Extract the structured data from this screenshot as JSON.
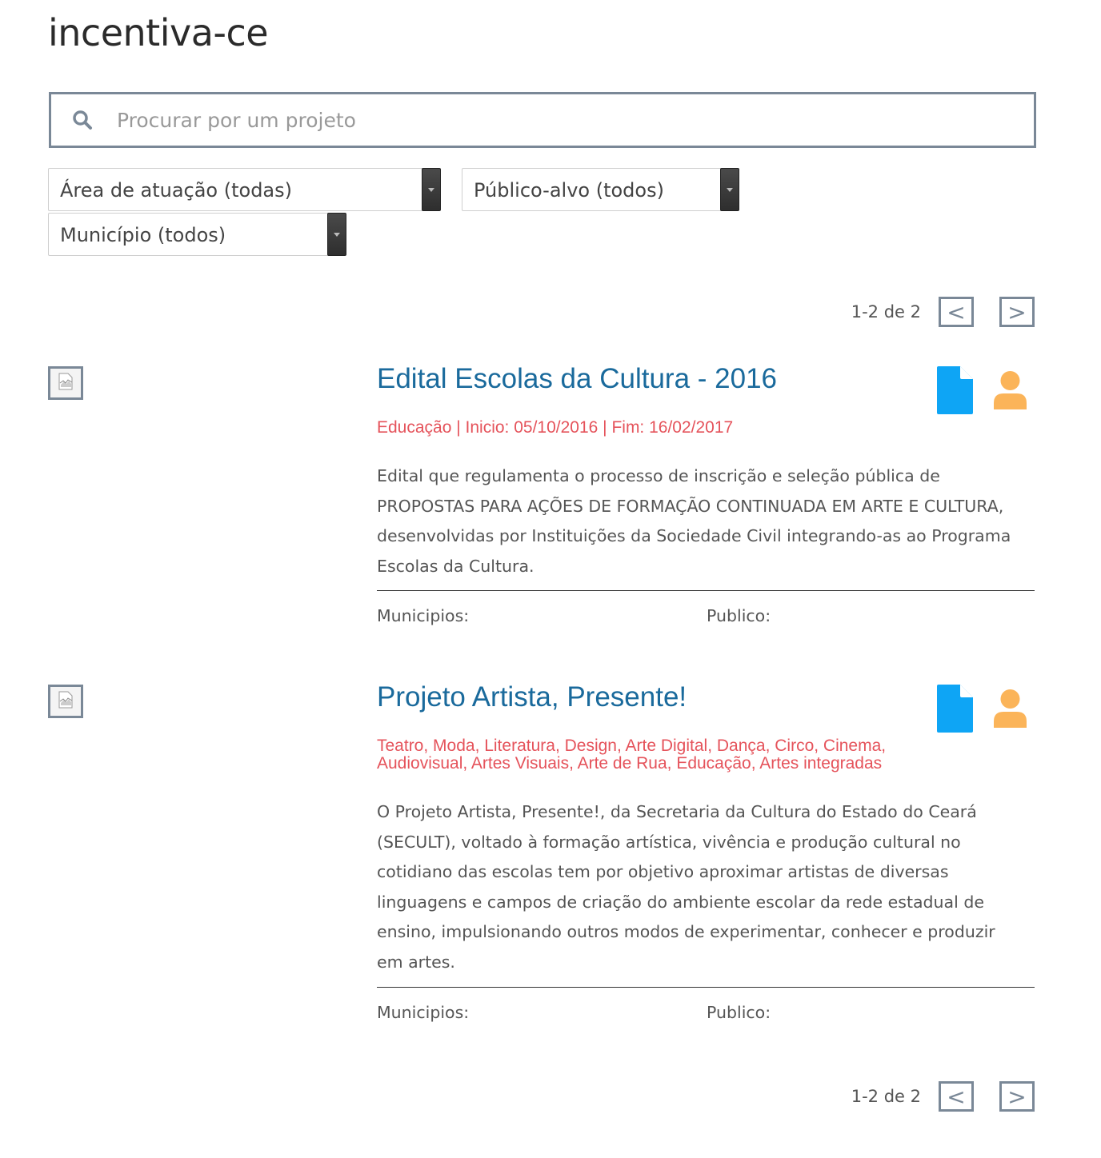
{
  "header": {
    "title": "incentiva-ce"
  },
  "search": {
    "placeholder": "Procurar por um projeto",
    "value": ""
  },
  "filters": {
    "area": "Área de atuação (todas)",
    "publico": "Público-alvo (todos)",
    "municipio": "Município (todos)"
  },
  "pagination": {
    "count": "1-2 de 2",
    "prev": "<",
    "next": ">"
  },
  "icons": {
    "search": "search-icon",
    "dropdown": "chevron-down-icon",
    "thumbnail": "broken-image-icon",
    "document": "document-icon",
    "user": "user-icon"
  },
  "colors": {
    "title": "#1a6a9c",
    "meta": "#e5535b",
    "document_icon": "#0ea5f5",
    "user_icon": "#fbb459",
    "border": "#7a8897"
  },
  "projects": [
    {
      "title": "Edital Escolas da Cultura - 2016",
      "meta": "Educação | Inicio: 05/10/2016 | Fim: 16/02/2017",
      "description": "Edital que regulamenta o processo de inscrição e seleção pública de PROPOSTAS PARA AÇÕES DE FORMAÇÃO CONTINUADA EM ARTE E CULTURA, desenvolvidas por Instituições da Sociedade Civil integrando-as ao Programa Escolas da Cultura.",
      "municipios_label": "Municipios:",
      "publico_label": "Publico:"
    },
    {
      "title": "Projeto Artista, Presente!",
      "meta": "Teatro, Moda, Literatura, Design, Arte Digital, Dança, Circo, Cinema, Audiovisual, Artes Visuais, Arte de Rua, Educação, Artes integradas",
      "description": "O Projeto Artista, Presente!, da Secretaria da Cultura do Estado do Ceará (SECULT), voltado à formação artística, vivência e produção cultural no cotidiano das escolas tem por objetivo aproximar artistas de diversas linguagens e campos de criação do ambiente escolar da rede estadual de ensino, impulsionando outros modos de experimentar, conhecer e produzir em artes.",
      "municipios_label": "Municipios:",
      "publico_label": "Publico:"
    }
  ]
}
